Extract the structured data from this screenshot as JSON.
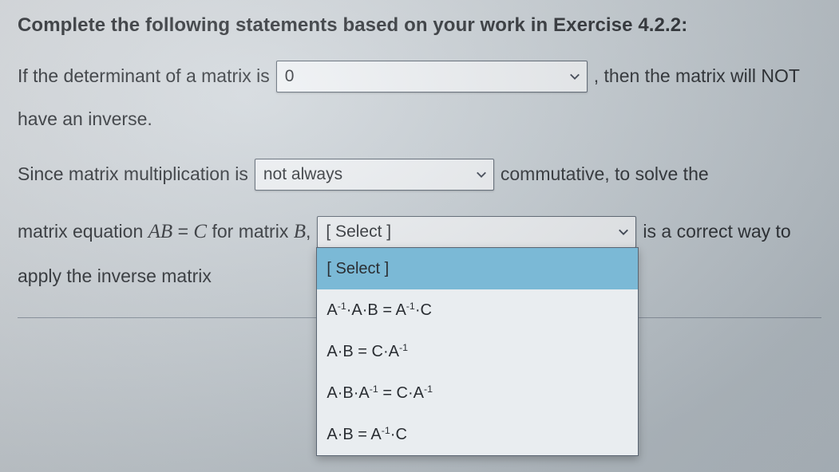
{
  "heading": "Complete the following statements based on your work in Exercise 4.2.2:",
  "line1": {
    "pre": "If the determinant of a matrix is",
    "select_value": "0",
    "post": ", then the matrix will NOT"
  },
  "line2": {
    "text": "have an inverse."
  },
  "line3": {
    "pre": "Since matrix multiplication is",
    "select_value": "not always",
    "post": "commutative, to solve the"
  },
  "line4": {
    "pre": "matrix equation ",
    "eq_lhs": "AB",
    "eq_eq": " = ",
    "eq_rhs": "C",
    "mid": " for matrix ",
    "mid_var": "B",
    "mid_comma": ",",
    "select_value": "[ Select ]",
    "post": "is a correct way to"
  },
  "line5": {
    "text": "apply the inverse matrix"
  },
  "dropdown": {
    "options": [
      "[ Select ]",
      "A⁻¹·A·B = A⁻¹·C",
      "A·B = C·A⁻¹",
      "A·B·A⁻¹ = C·A⁻¹",
      "A·B = A⁻¹·C"
    ],
    "highlight_index": 0
  }
}
